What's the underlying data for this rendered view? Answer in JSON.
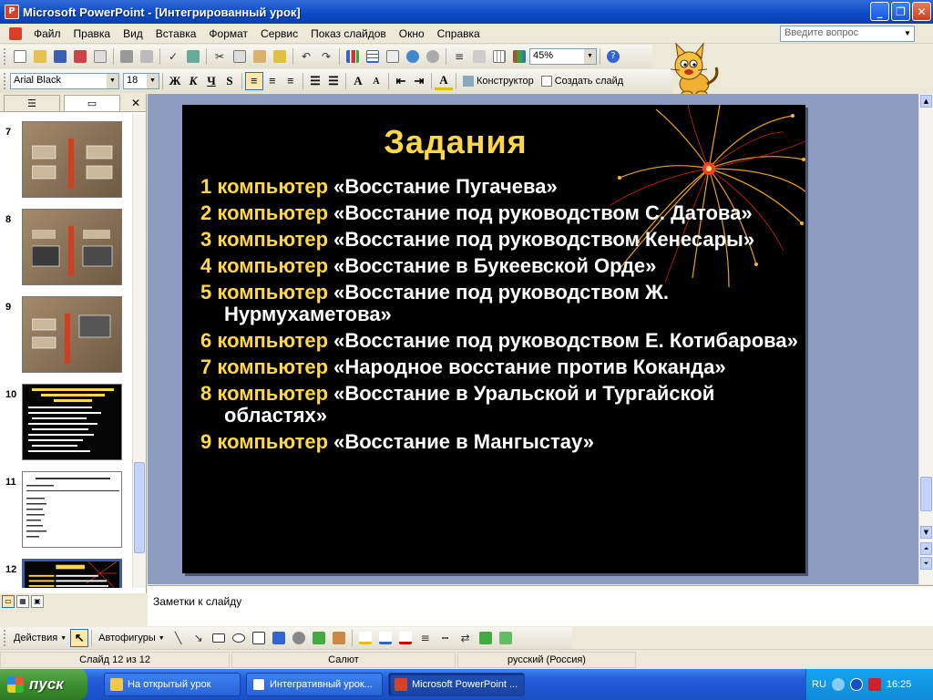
{
  "window": {
    "title": "Microsoft PowerPoint - [Интегрированный урок]",
    "buttons": [
      "_",
      "❐",
      "✕"
    ]
  },
  "menu": {
    "items": [
      "Файл",
      "Правка",
      "Вид",
      "Вставка",
      "Формат",
      "Сервис",
      "Показ слайдов",
      "Окно",
      "Справка"
    ],
    "help_placeholder": "Введите вопрос"
  },
  "toolbar": {
    "zoom": "45%",
    "font_name": "Arial Black",
    "font_size": "18",
    "bold": "Ж",
    "italic": "К",
    "underline": "Ч",
    "shadow": "S",
    "design_label": "Конструктор",
    "new_slide_label": "Создать слайд"
  },
  "slide_panel": {
    "thumbnails": [
      {
        "number": "7",
        "style": "brown"
      },
      {
        "number": "8",
        "style": "brown"
      },
      {
        "number": "9",
        "style": "brown"
      },
      {
        "number": "10",
        "style": "black"
      },
      {
        "number": "11",
        "style": "white"
      },
      {
        "number": "12",
        "style": "black",
        "selected": true
      }
    ]
  },
  "slide": {
    "title": "Задания",
    "items": [
      {
        "num": "1",
        "kw": "компьютер",
        "text": "«Восстание Пугачева»"
      },
      {
        "num": "2",
        "kw": "компьютер",
        "text": "«Восстание под руководством С. Датова»"
      },
      {
        "num": "3",
        "kw": "компьютер",
        "text": "«Восстание под руководством Кенесары»"
      },
      {
        "num": "4",
        "kw": "компьютер",
        "text": "«Восстание в Букеевской Орде»"
      },
      {
        "num": "5",
        "kw": "компьютер",
        "text": "«Восстание под руководством Ж. Нурмухаметова»"
      },
      {
        "num": "6",
        "kw": "компьютер",
        "text": "«Восстание под руководством Е. Котибарова»"
      },
      {
        "num": "7",
        "kw": "компьютер",
        "text": "«Народное восстание против Коканда»"
      },
      {
        "num": "8",
        "kw": "компьютер",
        "text": "«Восстание в Уральской и Тургайской областях»"
      },
      {
        "num": "9",
        "kw": "компьютер",
        "text": "«Восстание в Мангыстау»"
      }
    ]
  },
  "notes": {
    "placeholder": "Заметки к слайду"
  },
  "drawing": {
    "actions_label": "Действия",
    "autoshapes_label": "Автофигуры"
  },
  "status": {
    "slide": "Слайд 12 из 12",
    "design": "Салют",
    "language": "русский (Россия)"
  },
  "taskbar": {
    "start": "пуск",
    "tasks": [
      "На открытый урок",
      "Интегративный урок...",
      "Microsoft PowerPoint ..."
    ],
    "lang": "RU",
    "clock": "16:25"
  },
  "colors": {
    "slide_title": "#ffd84a",
    "slide_bg": "#000000",
    "workspace": "#8c9bbf"
  }
}
